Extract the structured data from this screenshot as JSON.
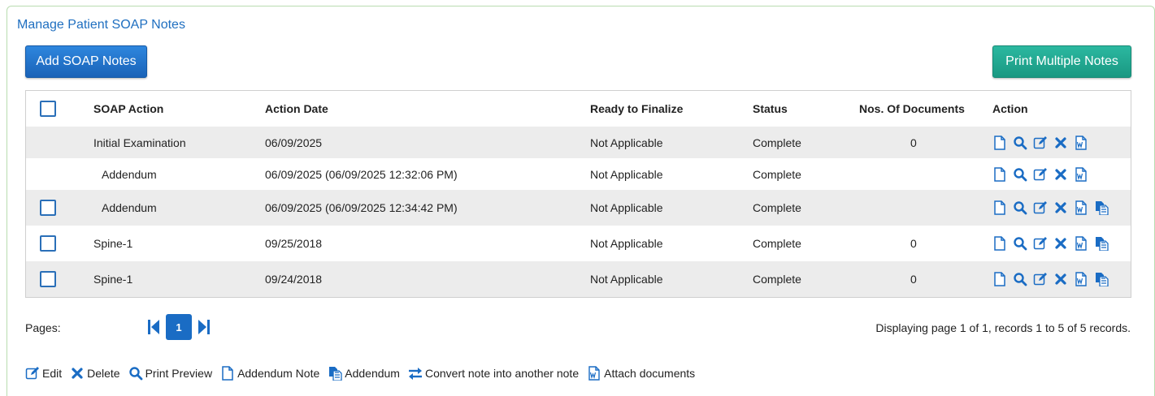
{
  "title": "Manage Patient SOAP Notes",
  "buttons": {
    "add": "Add SOAP Notes",
    "print_multiple": "Print Multiple Notes"
  },
  "columns": [
    "SOAP Action",
    "Action Date",
    "Ready to Finalize",
    "Status",
    "Nos. Of Documents",
    "Action"
  ],
  "rows": [
    {
      "action": "Initial Examination",
      "date": "06/09/2025",
      "ready": "Not Applicable",
      "status": "Complete",
      "docs": "0"
    },
    {
      "action": "Addendum",
      "date": "06/09/2025 (06/09/2025 12:32:06 PM)",
      "ready": "Not Applicable",
      "status": "Complete",
      "docs": ""
    },
    {
      "action": "Addendum",
      "date": "06/09/2025 (06/09/2025 12:34:42 PM)",
      "ready": "Not Applicable",
      "status": "Complete",
      "docs": ""
    },
    {
      "action": "Spine-1",
      "date": "09/25/2018",
      "ready": "Not Applicable",
      "status": "Complete",
      "docs": "0"
    },
    {
      "action": "Spine-1",
      "date": "09/24/2018",
      "ready": "Not Applicable",
      "status": "Complete",
      "docs": "0"
    }
  ],
  "pager": {
    "label": "Pages:",
    "current": "1",
    "info": "Displaying page 1 of 1, records 1 to 5 of 5 records."
  },
  "legend": {
    "edit": "Edit",
    "delete": "Delete",
    "print_preview": "Print Preview",
    "addendum_note": "Addendum Note",
    "addendum": "Addendum",
    "convert": "Convert note into another note",
    "attach": "Attach documents"
  },
  "colors": {
    "accent": "#1a6cc4",
    "teal": "#1a9882",
    "title": "#1f6fc0",
    "row_alt": "#ececec"
  }
}
